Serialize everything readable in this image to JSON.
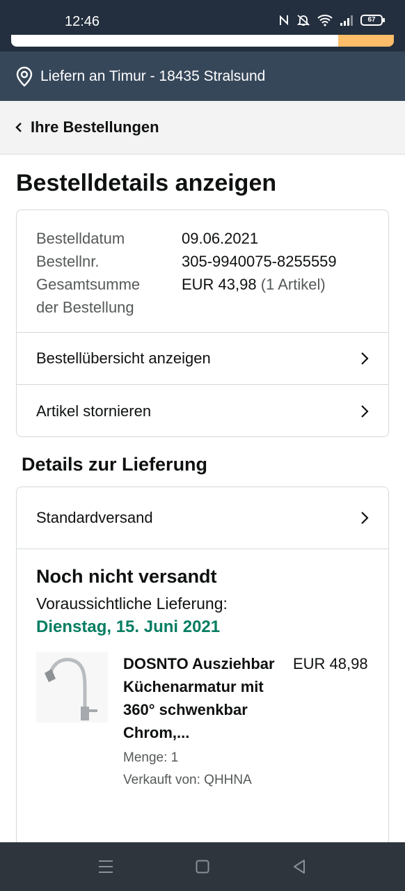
{
  "status_bar": {
    "time": "12:46",
    "battery": "67"
  },
  "location": {
    "text": "Liefern an Timur - 18435 Stralsund"
  },
  "breadcrumb": {
    "label": "Ihre Bestellungen"
  },
  "page": {
    "title": "Bestelldetails anzeigen"
  },
  "summary": {
    "date_label": "Bestelldatum",
    "date_value": "09.06.2021",
    "number_label": "Bestellnr.",
    "number_value": "305-9940075-8255559",
    "total_label_1": "Gesamtsumme",
    "total_label_2": "der Bestellung",
    "total_value": "EUR 43,98",
    "total_items": "(1 Artikel)"
  },
  "links": {
    "overview": "Bestellübersicht anzeigen",
    "cancel": "Artikel stornieren"
  },
  "delivery": {
    "section_title": "Details zur Lieferung",
    "shipping_method": "Standardversand",
    "status": "Noch nicht versandt",
    "eta_label": "Voraussichtliche Lieferung:",
    "eta_date": "Dienstag, 15. Juni 2021",
    "accent_color": "#067d62"
  },
  "product": {
    "title": "DOSNTO Ausziehbar Küchenarmatur mit 360° schwenkbar Chrom,...",
    "price": "EUR 48,98",
    "quantity": "Menge: 1",
    "seller": "Verkauft von: QHHNA",
    "image_icon": "kitchen-faucet-image"
  },
  "colors": {
    "header": "#232f3e",
    "location_bar": "#37475a",
    "search_button": "#febd69"
  }
}
